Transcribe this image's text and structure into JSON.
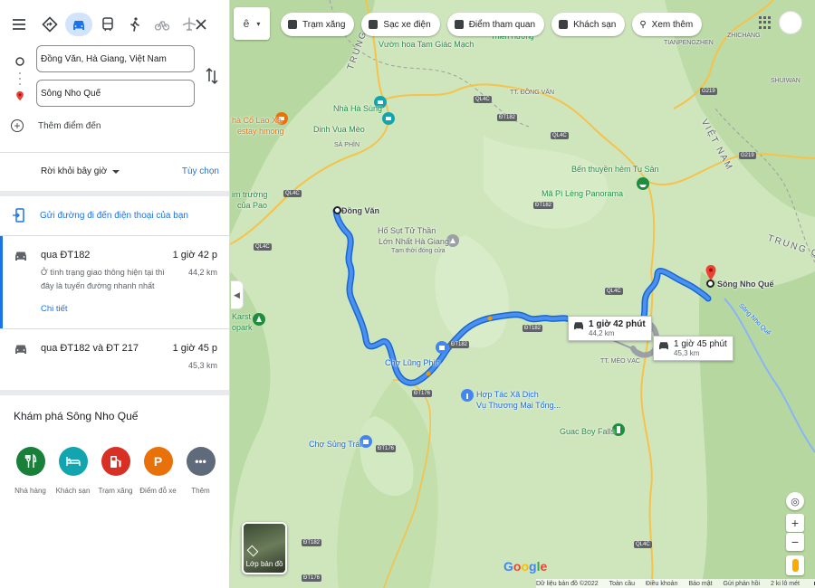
{
  "panel": {
    "origin": "Đồng Văn, Hà Giang, Việt Nam",
    "destination": "Sông Nho Quế",
    "add_destination": "Thêm điểm đến",
    "depart": "Rời khỏi bây giờ",
    "options": "Tùy chọn",
    "send_to_phone": "Gửi đường đi đến điện thoại của bạn",
    "routes": [
      {
        "via": "qua ĐT182",
        "time": "1 giờ 42 p",
        "distance": "44,2 km",
        "description": "Ở tình trạng giao thông hiện tại thì đây là tuyến đường nhanh nhất",
        "details": "Chi tiết"
      },
      {
        "via": "qua ĐT182 và ĐT 217",
        "time": "1 giờ 45 p",
        "distance": "45,3 km"
      }
    ],
    "explore_title": "Khám phá Sông Nho Quế",
    "categories": [
      {
        "label": "Nhà hàng",
        "icon": "restaurant-icon",
        "color": "#188038"
      },
      {
        "label": "Khách sạn",
        "icon": "hotel-icon",
        "color": "#12a4af"
      },
      {
        "label": "Trạm xăng",
        "icon": "gas-station-icon",
        "color": "#d93025"
      },
      {
        "label": "Điểm đỗ xe",
        "icon": "parking-icon",
        "color": "#e8710a"
      },
      {
        "label": "Thêm",
        "icon": "more-icon",
        "color": "#5f6b7a"
      }
    ]
  },
  "map": {
    "chips": [
      "Trạm xăng",
      "Sạc xe điện",
      "Điểm tham quan",
      "Khách sạn",
      "Xem thêm"
    ],
    "labels": {
      "origin": "Đồng Văn",
      "destination": "Sông Nho Quế",
      "vuon_hoa": "Vườn hoa Tam Giác Mạch",
      "nha_ha_sung": "Nhà Hà Sùng",
      "dinh_vua_meo": "Dinh Vua Mèo",
      "sa_phin": "SÀ PHÌN",
      "co_lao_xa": "hà Cổ Lao Xa",
      "homestay": "estay hmong",
      "tt_dong_van": "TT. ĐỒNG VĂN",
      "ben_thuyen": "Bến thuyền hẻm Tu Sản",
      "ma_pi_leng": "Mã Pì Lèng Panorama",
      "ho_sut": "Hố Sụt Tử Thần",
      "lon_nhat": "Lớn Nhất Hà Giang",
      "tam_thoi": "Tạm thời đóng cửa",
      "cho_lung_phin": "Chợ Lũng Phìn",
      "hop_tac_xa": "Hợp Tác Xã Dịch",
      "vu_thuong": "Vụ Thương Mại Tổng...",
      "cho_sung_trai": "Chợ Sủng Trái",
      "guac_boy": "Guac Boy Falls",
      "tt_meo_vac": "TT. MÈO VẠC",
      "karst": "Karst",
      "park": "opark",
      "truong": "im trường",
      "cua_pao": "của Pao",
      "thien_huong": "Thiên Hương",
      "trung_c": "TRUNG",
      "zhichang": "ZHICHANG",
      "tianpengzhen": "TIANPENGZHEN",
      "shuiwan": "SHUIWAN",
      "trung_quoc": "TRUNG QUỐ",
      "viet_nam": "VIỆT NAM",
      "song_nho_que_river": "Sông Nho Quế"
    },
    "roads": [
      "QL4C",
      "ĐT182",
      "ĐT176",
      "G219"
    ],
    "callouts": [
      {
        "time": "1 giờ 42 phút",
        "distance": "44,2 km"
      },
      {
        "time": "1 giờ 45 phút",
        "distance": "45,3 km"
      }
    ],
    "layers_label": "Lớp bản đồ",
    "footer": {
      "copyright": "Dữ liệu bản đồ ©2022",
      "global": "Toàn cầu",
      "terms": "Điều khoản",
      "privacy": "Bảo mật",
      "feedback": "Gửi phản hồi",
      "scale": "2 ki lô mét"
    }
  }
}
